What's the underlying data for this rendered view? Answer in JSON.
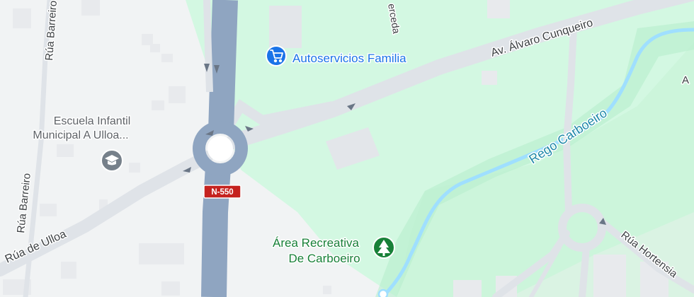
{
  "map": {
    "colors": {
      "park": "#d3f8e2",
      "urban": "#f1f3f4",
      "building": "#e8eaed",
      "road": "#dfe3e8",
      "highway": "#8fa5c1",
      "water": "#9fdfff",
      "poi_blue": "#1a73e8",
      "poi_green": "#188038",
      "poi_gray": "#5f6368",
      "shield_red": "#c5221f"
    },
    "streets": {
      "alvaro_cunqueiro": "Av. Álvaro Cunqueiro",
      "rua_barreiro_top": "Rúa Barreiro",
      "rua_barreiro_left": "Rúa Barreiro",
      "rua_de_ulloa": "Rúa de Ulloa",
      "hortensia": "Rúa Hortensia",
      "merceda": "erceda",
      "edge_fragment": "A"
    },
    "water": {
      "rego_carboeiro": "Rego Carboeiro"
    },
    "route_shield": "N-550",
    "pois": {
      "autoservicios": {
        "name": "Autoservicios Familia",
        "icon": "shopping-cart-icon"
      },
      "escuela": {
        "line1": "Escuela Infantil",
        "line2": "Municipal A Ulloa...",
        "icon": "school-icon"
      },
      "area_recreativa": {
        "line1": "Área Recreativa",
        "line2": "De Carboeiro",
        "icon": "tree-icon"
      }
    }
  }
}
